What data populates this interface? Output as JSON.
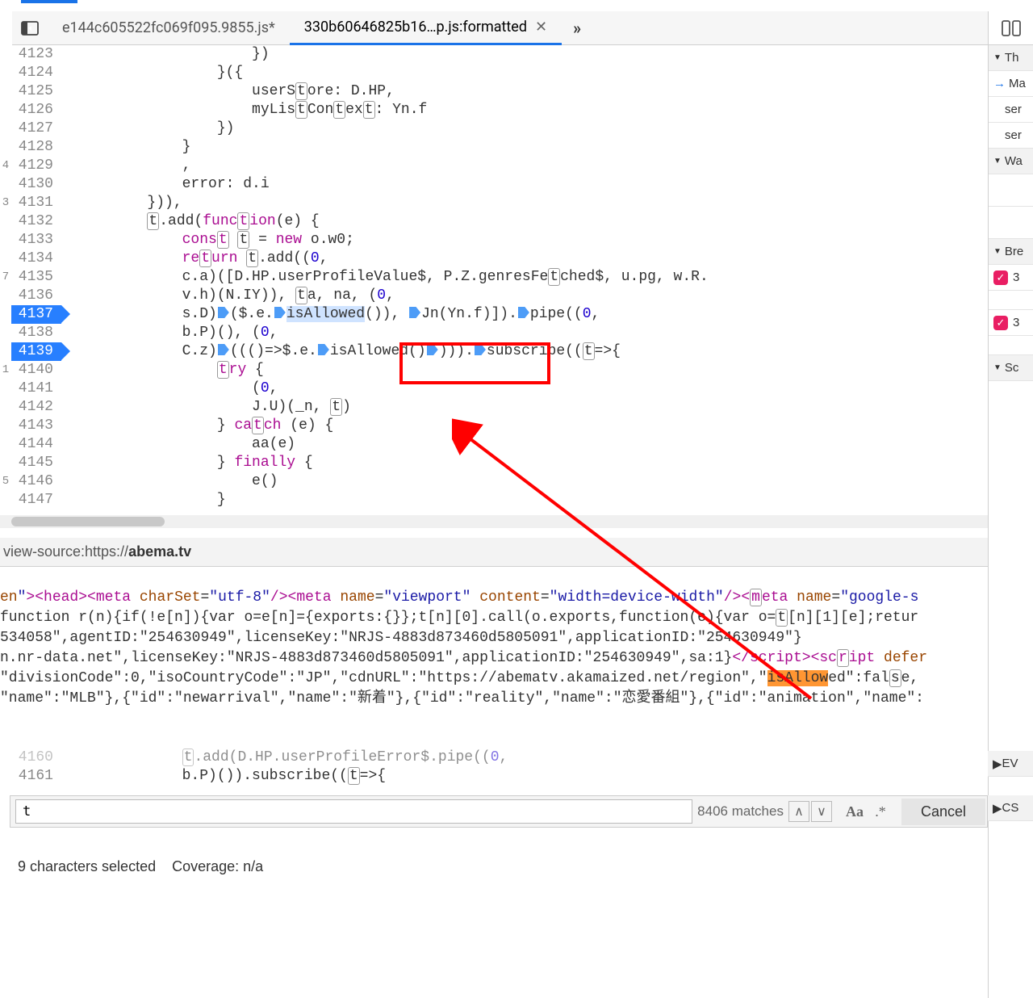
{
  "tabs": {
    "inactive_label": "e144c605522fc069f095.9855.js*",
    "active_label": "330b60646825b16…p.js:formatted"
  },
  "right_panel": {
    "sections": [
      "Th",
      "Ma",
      "ser",
      "ser",
      "Wa",
      "Bre",
      "3",
      "3",
      "Sc"
    ],
    "lower": [
      "EV",
      "CS"
    ]
  },
  "lines": [
    {
      "n": "4123",
      "m": "",
      "html": "                    })"
    },
    {
      "n": "4124",
      "m": "",
      "html": "                }({"
    },
    {
      "n": "4125",
      "m": "",
      "html": "                    userS<span class='boxed'>t</span>ore: D.HP,"
    },
    {
      "n": "4126",
      "m": "",
      "html": "                    myLis<span class='boxed'>t</span>Con<span class='boxed'>t</span>ex<span class='boxed'>t</span>: Yn.f"
    },
    {
      "n": "4127",
      "m": "",
      "html": "                })"
    },
    {
      "n": "4128",
      "m": "",
      "html": "            }"
    },
    {
      "n": "4129",
      "m": "4",
      "html": "            ,"
    },
    {
      "n": "4130",
      "m": "",
      "html": "            error: d.i"
    },
    {
      "n": "4131",
      "m": "3",
      "html": "        })),"
    },
    {
      "n": "4132",
      "m": "",
      "html": "        <span class='boxed'>t</span>.add(<span class='kw'>func<span class='boxed'>t</span>ion</span>(e) {"
    },
    {
      "n": "4133",
      "m": "",
      "html": "            <span class='kw'>cons<span class='boxed'>t</span></span> <span class='boxed'>t</span> = <span class='kw'>new</span> o.w0;"
    },
    {
      "n": "4134",
      "m": "",
      "html": "            <span class='kw'>re<span class='boxed'>t</span>urn</span> <span class='boxed'>t</span>.add((<span class='num'>0</span>,"
    },
    {
      "n": "4135",
      "m": "7",
      "html": "            c.a)([D.HP.userProfileValue$, P.Z.genresFe<span class='boxed'>t</span>ched$, u.pg, w.R."
    },
    {
      "n": "4136",
      "m": "",
      "html": "            v.h)(N.IY)), <span class='boxed'>t</span>a, na, (<span class='num'>0</span>,"
    },
    {
      "n": "4137",
      "m": "",
      "bp": true,
      "html": "            s.D)<span class='ptr'></span>($.e.<span class='ptr'></span><span class='hl-sel'>isAllowed</span>()), <span class='ptr'></span>Jn(Yn.f)]).<span class='ptr'></span>pipe((<span class='num'>0</span>,"
    },
    {
      "n": "4138",
      "m": "",
      "html": "            b.P)(), (<span class='num'>0</span>,"
    },
    {
      "n": "4139",
      "m": "",
      "bp": true,
      "html": "            C.z)<span class='ptr'></span>((()=&gt;$.e.<span class='ptr'></span>isAllowed()<span class='ptr'></span>))).<span class='ptr'></span>subscribe((<span class='boxed'>t</span>=&gt;{"
    },
    {
      "n": "4140",
      "m": "1",
      "html": "                <span class='kw'><span class='boxed'>t</span>ry</span> {"
    },
    {
      "n": "4141",
      "m": "",
      "html": "                    (<span class='num'>0</span>,"
    },
    {
      "n": "4142",
      "m": "",
      "html": "                    J.U)(_n, <span class='boxed'>t</span>)"
    },
    {
      "n": "4143",
      "m": "",
      "html": "                } <span class='kw'>ca<span class='boxed'>t</span>ch</span> (e) {"
    },
    {
      "n": "4144",
      "m": "",
      "html": "                    aa(e)"
    },
    {
      "n": "4145",
      "m": "",
      "html": "                } <span class='kw'>finally</span> {"
    },
    {
      "n": "4146",
      "m": "5",
      "html": "                    e()"
    },
    {
      "n": "4147",
      "m": "",
      "html": "                }"
    }
  ],
  "view_source": {
    "prefix": "view-source:https://",
    "host": "abema.tv"
  },
  "raw_lines": [
    "<span class='attr'>en</span><span class='str'>\"</span><span class='tag'>&gt;&lt;head&gt;&lt;meta</span> <span class='attr'>charSet</span>=<span class='str'>\"utf-8\"</span><span class='tag'>/&gt;&lt;meta</span> <span class='attr'>name</span>=<span class='str'>\"viewport\"</span> <span class='attr'>content</span>=<span class='str'>\"width=device-width\"</span><span class='tag'>/&gt;&lt;<span class='boxed'>m</span>eta</span> <span class='attr'>name</span>=<span class='str'>\"google-s</span>",
    "function r(n){if(!e[n]){var o=e[n]={exports:{}};t[n][0].call(o.exports,function(e){var o=<span class='boxed'>t</span>[n][1][e];retur",
    "534058\",agentID:\"254630949\",licenseKey:\"NRJS-4883d873460d5805091\",applicationID:\"254630949\"}",
    "n.nr-data.net\",licenseKey:\"NRJS-4883d873460d5805091\",applicationID:\"254630949\",sa:1}<span class='tag'>&lt;/script&gt;&lt;sc<span class='boxed'>r</span>ipt</span> <span class='attr'>defer</span>",
    "",
    "\"divisionCode\":0,\"isoCountryCode\":\"JP\",\"cdnURL\":\"https://abematv.akamaized.net/region\",\"<span class='hlt'>isAllow</span>ed\":fal<span class='boxed'>s</span>e,",
    "\"name\":\"MLB\"},{\"id\":\"newarrival\",\"name\":\"新着\"},{\"id\":\"reality\",\"name\":\"恋愛番組\"},{\"id\":\"animation\",\"name\":"
  ],
  "lower_lines": [
    {
      "n": "4160",
      "m": "",
      "html": "            <span class='boxed'>t</span>.add(D.HP.userProfileError$.pipe((<span class='num'>0</span>,"
    },
    {
      "n": "4161",
      "m": "",
      "html": "            b.P)()).subscribe((<span class='boxed'>t</span>=&gt;{"
    }
  ],
  "search": {
    "query": "t",
    "matches": "8406 matches",
    "cancel": "Cancel",
    "case_label": "Aa",
    "regex_label": ".*"
  },
  "status": {
    "selection": "9 characters selected",
    "coverage": "Coverage: n/a"
  }
}
